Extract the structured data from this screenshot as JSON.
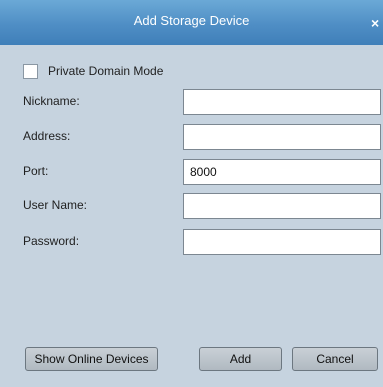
{
  "dialog": {
    "title": "Add Storage Device",
    "close_glyph": "×"
  },
  "checkbox": {
    "label": "Private Domain Mode",
    "checked": false
  },
  "fields": [
    {
      "label": "Nickname:",
      "value": ""
    },
    {
      "label": "Address:",
      "value": ""
    },
    {
      "label": "Port:",
      "value": "8000"
    },
    {
      "label": "User Name:",
      "value": ""
    },
    {
      "label": "Password:",
      "value": ""
    }
  ],
  "buttons": {
    "show_online_devices": "Show Online Devices",
    "add": "Add",
    "cancel": "Cancel"
  },
  "colors": {
    "titlebar": "#4f8ec5",
    "body": "#c6d3df"
  }
}
